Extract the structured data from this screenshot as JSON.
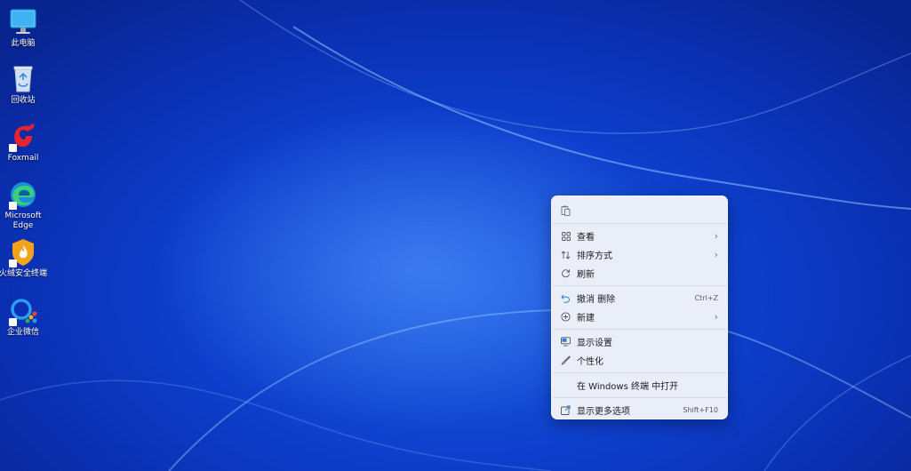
{
  "desktop": {
    "icons": [
      {
        "label": "此电脑",
        "icon": "computer-icon"
      },
      {
        "label": "回收站",
        "icon": "recycle-bin-icon"
      },
      {
        "label": "Foxmail",
        "icon": "foxmail-icon"
      },
      {
        "label": "Microsoft Edge",
        "icon": "edge-icon"
      },
      {
        "label": "火绒安全终端",
        "icon": "huorong-icon"
      },
      {
        "label": "企业微信",
        "icon": "wecom-icon"
      }
    ]
  },
  "context_menu": {
    "top_icon": "paste-icon",
    "items": {
      "view": {
        "label": "查看",
        "icon": "grid-icon"
      },
      "sort": {
        "label": "排序方式",
        "icon": "sort-icon"
      },
      "refresh": {
        "label": "刷新",
        "icon": "refresh-icon"
      },
      "undo": {
        "label": "撤消 删除",
        "icon": "undo-icon",
        "shortcut": "Ctrl+Z"
      },
      "new": {
        "label": "新建",
        "icon": "plus-circle-icon"
      },
      "display": {
        "label": "显示设置",
        "icon": "display-icon"
      },
      "personalize": {
        "label": "个性化",
        "icon": "brush-icon"
      },
      "terminal": {
        "label": "在 Windows 终端 中打开"
      },
      "more": {
        "label": "显示更多选项",
        "icon": "share-icon",
        "shortcut": "Shift+F10"
      }
    }
  },
  "colors": {
    "wallpaper": "#0d3fcc",
    "menu_bg": "#e9eef8",
    "undo_icon": "#2b7fd9"
  }
}
